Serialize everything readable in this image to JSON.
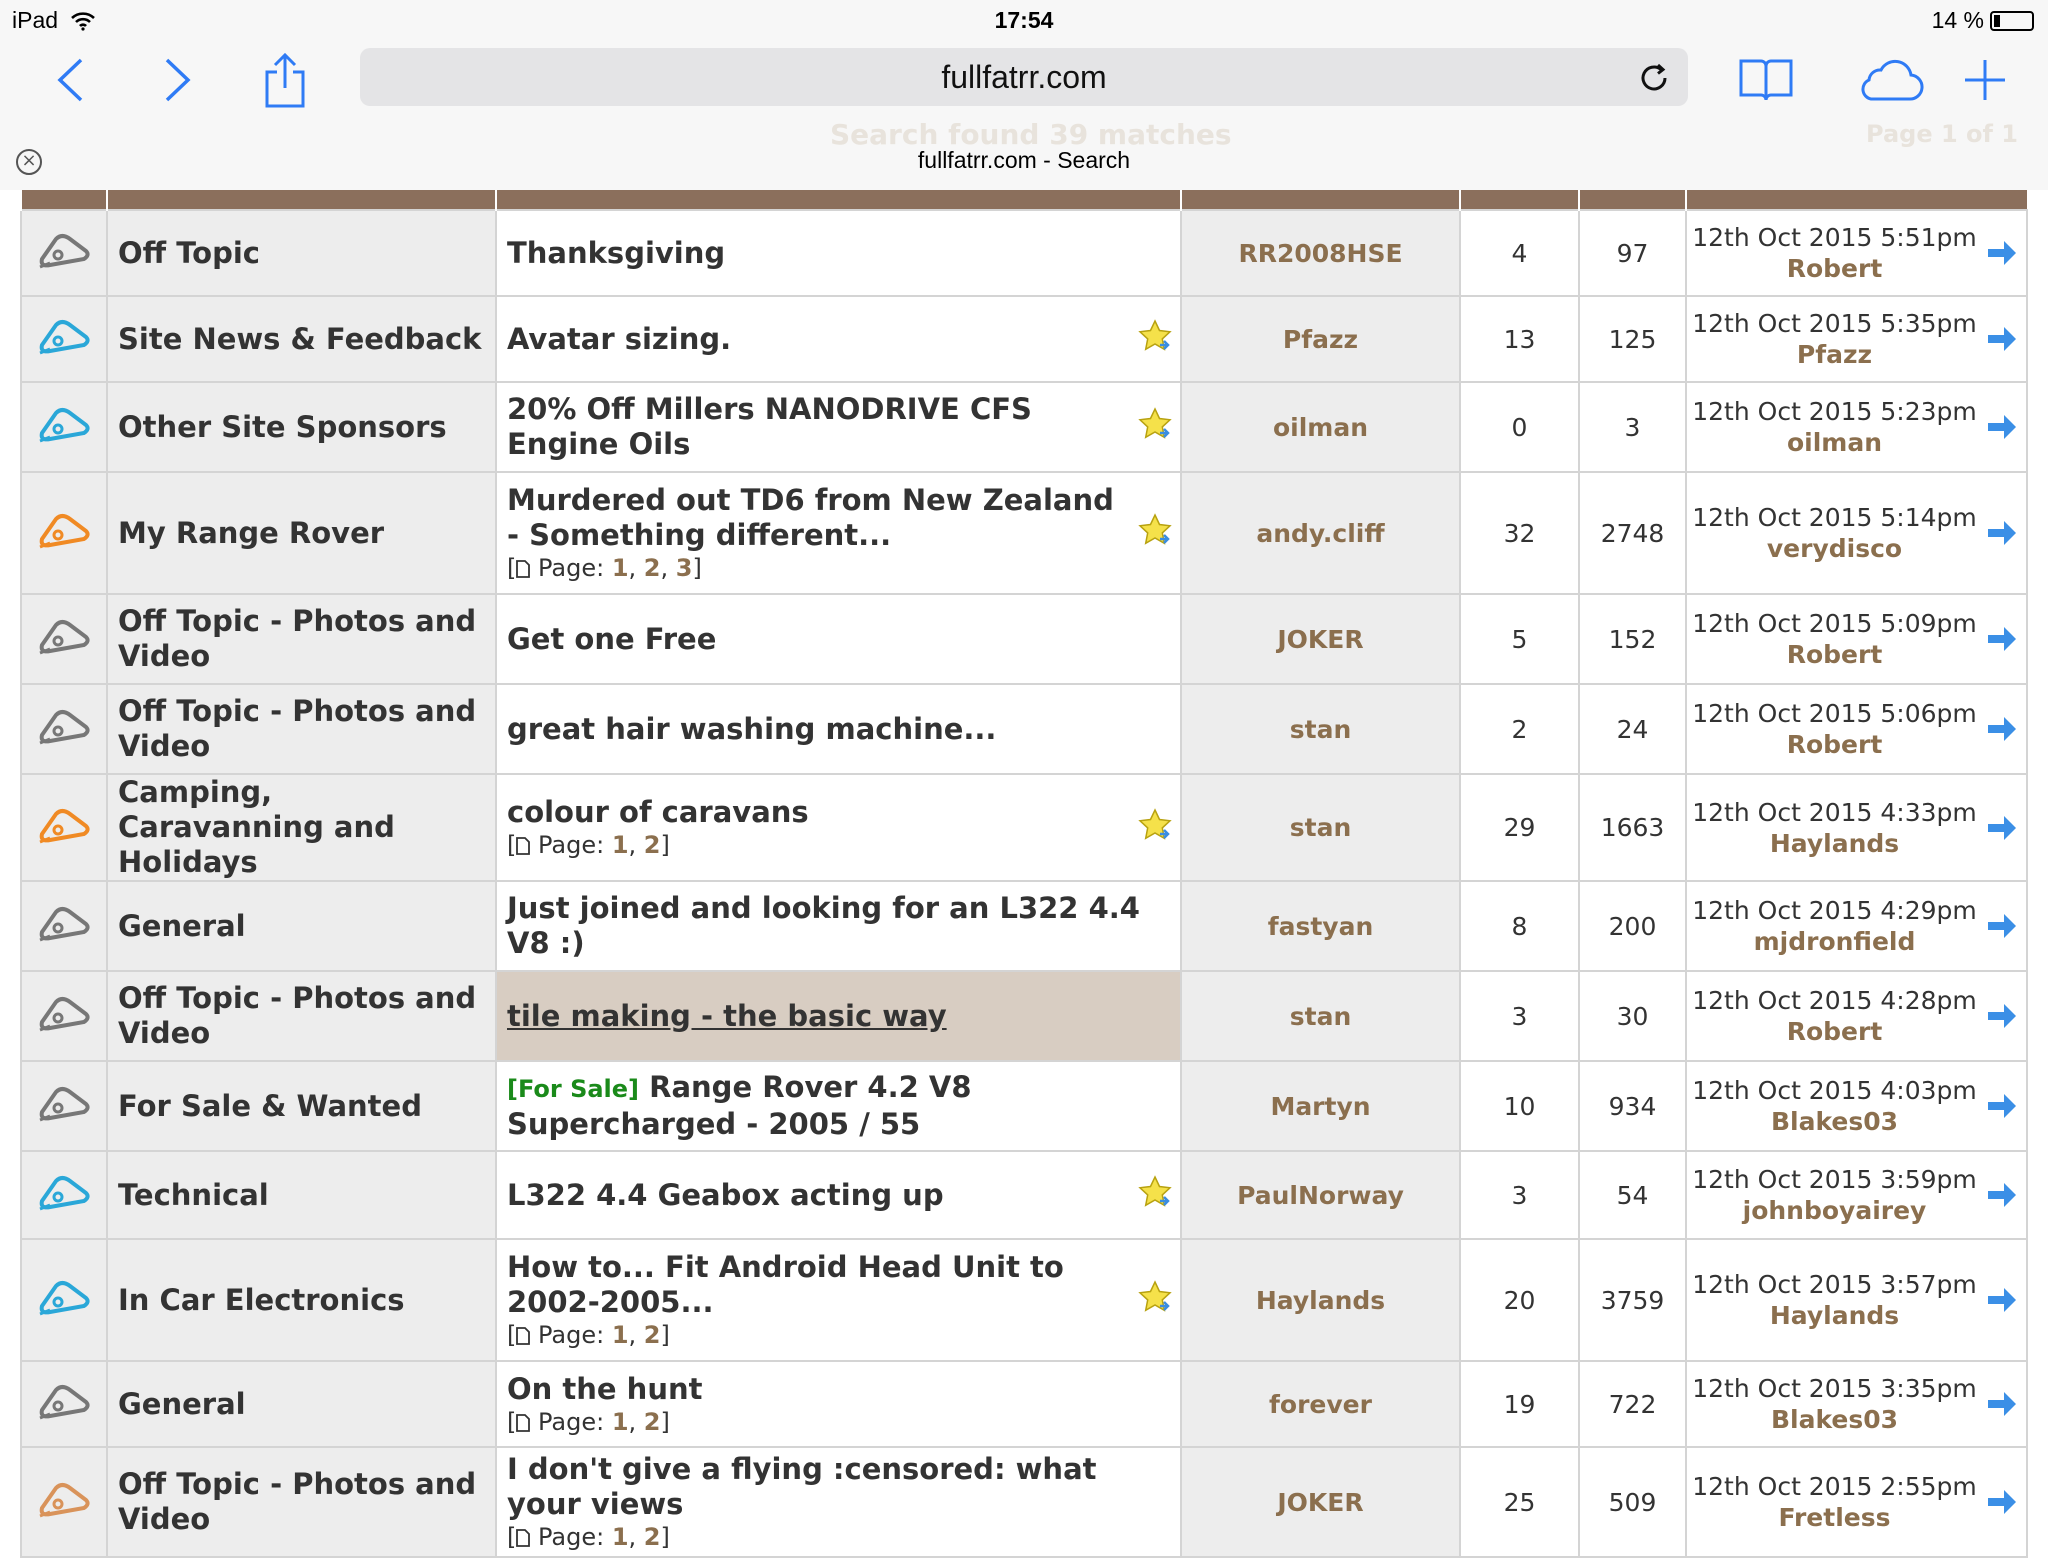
{
  "status_bar": {
    "device": "iPad",
    "time": "17:54",
    "battery": "14 %"
  },
  "browser": {
    "url": "fullfatrr.com",
    "tab_title": "fullfatrr.com - Search",
    "ghost_heading": "Search found 39 matches",
    "ghost_page": "Page 1 of 1"
  },
  "colors": {
    "header_bar": "#8b6f5c",
    "link_brown": "#8b6f4e",
    "highlight": "#d8cdc2",
    "sale_green": "#1a8a1a"
  },
  "rows": [
    {
      "icon": "grey",
      "forum": "Off Topic",
      "thread": "Thanksgiving",
      "star": false,
      "pages": null,
      "starter": "RR2008HSE",
      "replies": "4",
      "views": "97",
      "last_date": "12th Oct 2015 5:51pm",
      "last_user": "Robert"
    },
    {
      "icon": "blue",
      "forum": "Site News & Feedback",
      "thread": "Avatar sizing.",
      "star": true,
      "pages": null,
      "starter": "Pfazz",
      "replies": "13",
      "views": "125",
      "last_date": "12th Oct 2015 5:35pm",
      "last_user": "Pfazz"
    },
    {
      "icon": "blue",
      "forum": "Other Site Sponsors",
      "thread": "20% Off Millers NANODRIVE CFS Engine Oils",
      "star": true,
      "pages": null,
      "starter": "oilman",
      "replies": "0",
      "views": "3",
      "last_date": "12th Oct 2015 5:23pm",
      "last_user": "oilman"
    },
    {
      "icon": "orange",
      "forum": "My Range Rover",
      "thread": "Murdered out TD6 from New Zealand - Something different...",
      "star": true,
      "pages": [
        "1",
        "2",
        "3"
      ],
      "starter": "andy.cliff",
      "replies": "32",
      "views": "2748",
      "last_date": "12th Oct 2015 5:14pm",
      "last_user": "verydisco"
    },
    {
      "icon": "grey",
      "forum": "Off Topic - Photos and Video",
      "thread": "Get one Free",
      "star": false,
      "pages": null,
      "starter": "JOKER",
      "replies": "5",
      "views": "152",
      "last_date": "12th Oct 2015 5:09pm",
      "last_user": "Robert"
    },
    {
      "icon": "grey",
      "forum": "Off Topic - Photos and Video",
      "thread": "great hair washing machine...",
      "star": false,
      "pages": null,
      "starter": "stan",
      "replies": "2",
      "views": "24",
      "last_date": "12th Oct 2015 5:06pm",
      "last_user": "Robert"
    },
    {
      "icon": "orange",
      "forum": "Camping, Caravanning and Holidays",
      "thread": "colour of caravans",
      "star": true,
      "pages": [
        "1",
        "2"
      ],
      "starter": "stan",
      "replies": "29",
      "views": "1663",
      "last_date": "12th Oct 2015 4:33pm",
      "last_user": "Haylands"
    },
    {
      "icon": "grey",
      "forum": "General",
      "thread": "Just joined and looking for an L322 4.4 V8 :)",
      "star": false,
      "pages": null,
      "starter": "fastyan",
      "replies": "8",
      "views": "200",
      "last_date": "12th Oct 2015 4:29pm",
      "last_user": "mjdronfield"
    },
    {
      "icon": "grey",
      "forum": "Off Topic - Photos and Video",
      "thread": "tile making - the basic way",
      "star": false,
      "pages": null,
      "highlight": true,
      "starter": "stan",
      "replies": "3",
      "views": "30",
      "last_date": "12th Oct 2015 4:28pm",
      "last_user": "Robert"
    },
    {
      "icon": "grey",
      "forum": "For Sale & Wanted",
      "prefix": "[For Sale]",
      "thread": "Range Rover 4.2 V8 Supercharged - 2005 / 55",
      "star": false,
      "pages": null,
      "starter": "Martyn",
      "replies": "10",
      "views": "934",
      "last_date": "12th Oct 2015 4:03pm",
      "last_user": "Blakes03"
    },
    {
      "icon": "blue",
      "forum": "Technical",
      "thread": "L322 4.4 Geabox acting up",
      "star": true,
      "pages": null,
      "starter": "PaulNorway",
      "replies": "3",
      "views": "54",
      "last_date": "12th Oct 2015 3:59pm",
      "last_user": "johnboyairey"
    },
    {
      "icon": "blue",
      "forum": "In Car Electronics",
      "thread": "How to... Fit Android Head Unit to 2002-2005...",
      "star": true,
      "pages": [
        "1",
        "2"
      ],
      "starter": "Haylands",
      "replies": "20",
      "views": "3759",
      "last_date": "12th Oct 2015 3:57pm",
      "last_user": "Haylands"
    },
    {
      "icon": "grey",
      "forum": "General",
      "thread": "On the hunt",
      "star": false,
      "pages": [
        "1",
        "2"
      ],
      "starter": "forever",
      "replies": "19",
      "views": "722",
      "last_date": "12th Oct 2015 3:35pm",
      "last_user": "Blakes03"
    },
    {
      "icon": "orange2",
      "forum": "Off Topic - Photos and Video",
      "thread": "I don't give a flying :censored: what your views",
      "star": false,
      "pages": [
        "1",
        "2"
      ],
      "starter": "JOKER",
      "replies": "25",
      "views": "509",
      "last_date": "12th Oct 2015 2:55pm",
      "last_user": "Fretless"
    }
  ]
}
